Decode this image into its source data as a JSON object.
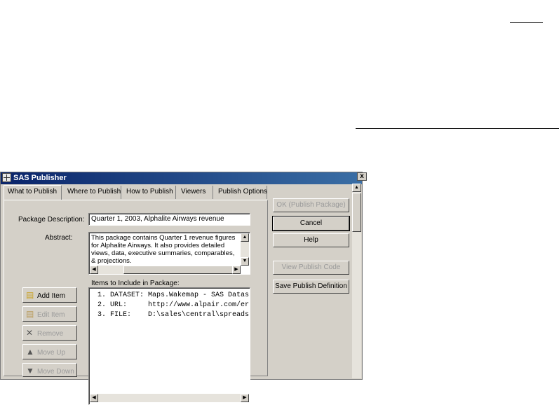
{
  "window": {
    "title": "SAS Publisher",
    "close_label": "x"
  },
  "tabs": [
    {
      "label": "What to Publish",
      "active": true
    },
    {
      "label": "Where to Publish"
    },
    {
      "label": "How to Publish"
    },
    {
      "label": "Viewers"
    },
    {
      "label": "Publish Options"
    }
  ],
  "form": {
    "package_description_label": "Package Description:",
    "package_description_value": "Quarter 1, 2003, Alphalite Airways revenue",
    "abstract_label": "Abstract:",
    "abstract_lines": [
      "This package contains Quarter 1 revenue figures",
      "for Alphalite Airways.  It also provides detailed",
      "views, data, executive summaries, comparables,",
      "& projections."
    ],
    "items_label": "Items to Include in Package:",
    "items": [
      "1. DATASET: Maps.Wakemap - SAS Datas",
      "2. URL:     http://www.alpair.com/er",
      "3. FILE:    D:\\sales\\central\\spreads"
    ]
  },
  "item_buttons": {
    "add": "Add Item",
    "edit": "Edit Item",
    "remove": "Remove",
    "move_up": "Move Up",
    "move_down": "Move Down"
  },
  "right_buttons": {
    "ok": "OK (Publish Package)",
    "cancel": "Cancel",
    "help": "Help",
    "view_code": "View Publish Code",
    "save_definition": "Save Publish Definition"
  }
}
